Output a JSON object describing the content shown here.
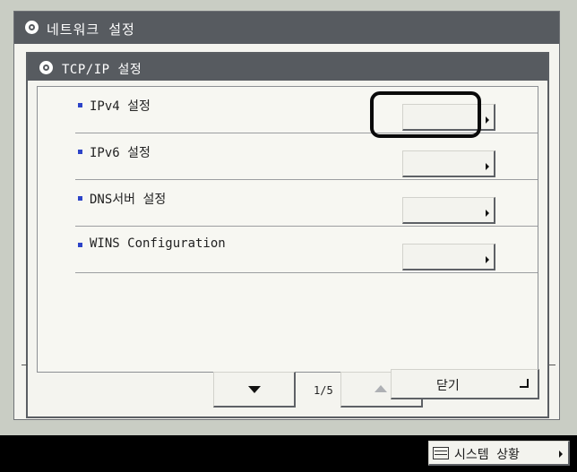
{
  "window": {
    "title": "네트워크 설정",
    "icon": "canon-logo-icon"
  },
  "panel": {
    "title": "TCP/IP 설정",
    "icon": "canon-logo-icon"
  },
  "items": [
    {
      "label": "IPv4 설정",
      "selected": true
    },
    {
      "label": "IPv6 설정",
      "selected": false
    },
    {
      "label": "DNS서버 설정",
      "selected": false
    },
    {
      "label": "WINS Configuration",
      "selected": false
    }
  ],
  "pager": {
    "page": "1/5",
    "down_icon": "triangle-down-icon",
    "up_icon": "triangle-up-icon",
    "up_enabled": false
  },
  "close_label": "닫기",
  "status": {
    "label": "시스템 상황",
    "icon": "status-monitor-icon"
  },
  "colors": {
    "title_bar": "#575b60",
    "bullet": "#2d44c8",
    "background": "#c9cdc4",
    "bottom_bar": "#000000"
  }
}
